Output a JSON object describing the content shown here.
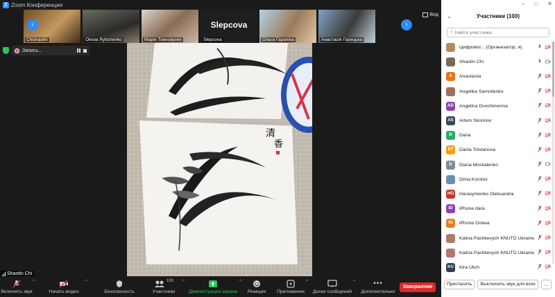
{
  "app": {
    "title": "Zoom Конференция",
    "zoom_letter": "Z"
  },
  "window_controls": [
    "–",
    "□",
    "✕"
  ],
  "thumbnails": [
    {
      "name": "Chishaotin"
    },
    {
      "name": "Olesia Rybchenko"
    },
    {
      "name": "Марія Тоензаузен"
    },
    {
      "name": "Slepcova",
      "big_name": "Slepcova"
    },
    {
      "name": "Ольга Гарапіна"
    },
    {
      "name": "Анастасія Горецька"
    }
  ],
  "view_button": "Вид",
  "recording": {
    "label": "Запись..."
  },
  "self_view": {
    "name": "Shaotin Chi"
  },
  "toolbar": {
    "unmute": "Включить звук",
    "video": "Начать видео",
    "security": "Безопасность",
    "participants": "Участники",
    "participants_count": "100",
    "share": "Демонстрация экрана",
    "reactions": "Реакции",
    "apps": "Приложения",
    "whiteboards": "Доски сообщений",
    "more": "Дополнительно",
    "end": "Завершение"
  },
  "panel": {
    "title": "Участники (100)",
    "search_placeholder": "Найти участника",
    "invite": "Пригласить",
    "mute_all": "Выключить звук для всех",
    "more": "..."
  },
  "participants": [
    {
      "initials": "",
      "name": "Цифровог... (Организатор, я)",
      "color": "#b58a5a",
      "mic_muted": false,
      "video_off": true
    },
    {
      "initials": "",
      "name": "Shaotin Chi",
      "color": "#7a6a5a",
      "mic_muted": false,
      "video_off": false
    },
    {
      "initials": "A",
      "name": "Anastasiia",
      "color": "#e8731c",
      "mic_muted": true,
      "video_off": true
    },
    {
      "initials": "",
      "name": "Angelika Samoilenko",
      "color": "#a0705a",
      "mic_muted": true,
      "video_off": true
    },
    {
      "initials": "AD",
      "name": "Angelina Dvochimenna",
      "color": "#8e44ad",
      "mic_muted": true,
      "video_off": true
    },
    {
      "initials": "AS",
      "name": "Artem Skorinov",
      "color": "#34495e",
      "mic_muted": true,
      "video_off": true
    },
    {
      "initials": "D",
      "name": "Daria",
      "color": "#27ae60",
      "mic_muted": true,
      "video_off": true
    },
    {
      "initials": "DT",
      "name": "Dariia Tolstanova",
      "color": "#f39c12",
      "mic_muted": true,
      "video_off": true
    },
    {
      "initials": "D",
      "name": "Diana Moskalenko",
      "color": "#7f8c9a",
      "mic_muted": true,
      "video_off": false
    },
    {
      "initials": "",
      "name": "Dima Korolov",
      "color": "#6a8fb5",
      "mic_muted": true,
      "video_off": true
    },
    {
      "initials": "HO",
      "name": "Harasymenko Oleksandra",
      "color": "#c0392b",
      "mic_muted": true,
      "video_off": true
    },
    {
      "initials": "ID",
      "name": "iPhone dara",
      "color": "#8e44ad",
      "mic_muted": true,
      "video_off": true
    },
    {
      "initials": "IO",
      "name": "iPhone Олена",
      "color": "#e67e22",
      "mic_muted": true,
      "video_off": true
    },
    {
      "initials": "",
      "name": "Kalina Pashkevych KNUTD Ukraine",
      "color": "#b07a6a",
      "mic_muted": true,
      "video_off": true
    },
    {
      "initials": "",
      "name": "Kalina Pashkevych KNUTD Ukraine",
      "color": "#b07a6a",
      "mic_muted": true,
      "video_off": true
    },
    {
      "initials": "KU",
      "name": "Kira Ulich",
      "color": "#2c3e50",
      "mic_muted": true,
      "video_off": true
    }
  ],
  "colors": {
    "accent": "#2d8cff",
    "end": "#e02828",
    "share_green": "#28c75a",
    "muted_red": "#e04040"
  }
}
